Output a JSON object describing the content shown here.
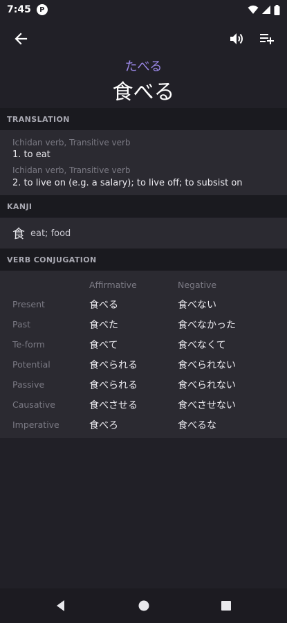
{
  "status_bar": {
    "time": "7:45",
    "notification_glyph": "P",
    "icons": [
      "wifi-icon",
      "signal-icon",
      "battery-icon"
    ]
  },
  "app_bar": {
    "back_icon": "arrow-back-icon",
    "audio_icon": "speaker-icon",
    "add_list_icon": "playlist-add-icon"
  },
  "entry": {
    "reading": "たべる",
    "word": "食べる",
    "reading_color": "#9a87e6"
  },
  "sections": {
    "translation": "TRANSLATION",
    "kanji": "KANJI",
    "conjugation": "VERB CONJUGATION"
  },
  "senses": [
    {
      "pos": "Ichidan verb, Transitive verb",
      "gloss": "1. to eat"
    },
    {
      "pos": "Ichidan verb, Transitive verb",
      "gloss": "2. to live on (e.g. a salary); to live off; to subsist on"
    }
  ],
  "kanji": [
    {
      "char": "食",
      "meaning": "eat; food"
    }
  ],
  "conjugation": {
    "headers": {
      "affirmative": "Affirmative",
      "negative": "Negative"
    },
    "rows": [
      {
        "label": "Present",
        "affirmative": "食べる",
        "negative": "食べない"
      },
      {
        "label": "Past",
        "affirmative": "食べた",
        "negative": "食べなかった"
      },
      {
        "label": "Te-form",
        "affirmative": "食べて",
        "negative": "食べなくて"
      },
      {
        "label": "Potential",
        "affirmative": "食べられる",
        "negative": "食べられない"
      },
      {
        "label": "Passive",
        "affirmative": "食べられる",
        "negative": "食べられない"
      },
      {
        "label": "Causative",
        "affirmative": "食べさせる",
        "negative": "食べさせない"
      },
      {
        "label": "Imperative",
        "affirmative": "食べろ",
        "negative": "食べるな"
      }
    ]
  },
  "nav_bar": {
    "icons": [
      "back-triangle-icon",
      "home-circle-icon",
      "recents-square-icon"
    ]
  }
}
